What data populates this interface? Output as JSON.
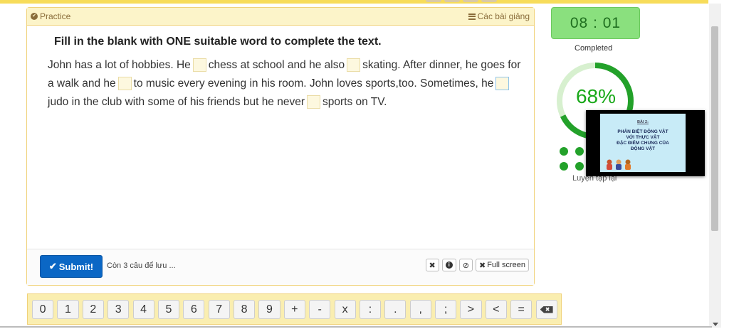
{
  "header": {
    "practice_label": "Practice",
    "lessons_label": "Các bài giảng"
  },
  "exercise": {
    "instruction": "Fill in the blank with ONE suitable word to complete the text.",
    "segments": [
      "John has a lot of hobbies. He",
      "chess at school and he also",
      "skating. After dinner, he goes for a walk and he",
      "to music every evening in his room. John loves sports,too. Sometimes, he",
      "judo in the club with some of his friends but he never",
      "sports on TV."
    ]
  },
  "footer": {
    "submit_label": "Submit!",
    "save_note": "Còn 3 câu để lưu ...",
    "close_symbol": "✖",
    "info_symbol": "i",
    "block_symbol": "⊘",
    "fullscreen_label": "Full screen"
  },
  "keypad": {
    "keys": [
      "0",
      "1",
      "2",
      "3",
      "4",
      "5",
      "6",
      "7",
      "8",
      "9",
      "+",
      "-",
      "x",
      ":",
      ".",
      ",",
      ";",
      ">",
      "<",
      "="
    ],
    "backspace_symbol": "✖"
  },
  "status": {
    "timer": "08 : 01",
    "completed_label": "Completed",
    "percent_text": "68%",
    "progress_fraction": 0.68,
    "retry_label": "Luyện tập lại"
  },
  "video": {
    "lesson_number": "BÀI 2:",
    "lesson_title": "PHÂN BIỆT ĐỘNG VẬT\nVỚI THỰC VẬT\nĐẶC ĐIỂM CHUNG CỦA\nĐỘNG VẬT"
  },
  "colors": {
    "accent_yellow": "#f7dc5a",
    "submit_blue": "#0b67c5",
    "timer_green": "#8ae07e",
    "progress_green": "#23a12a",
    "progress_track": "#d7f0cf"
  }
}
